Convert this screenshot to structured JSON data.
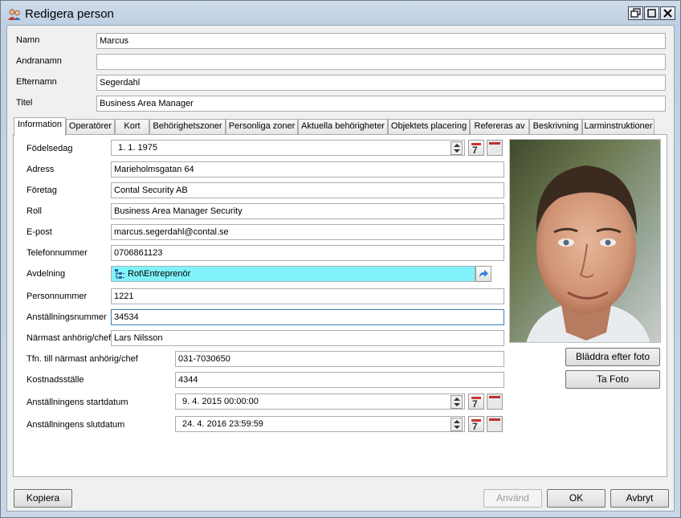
{
  "window": {
    "title": "Redigera person"
  },
  "header_fields": [
    {
      "label": "Namn",
      "value": "Marcus"
    },
    {
      "label": "Andranamn",
      "value": ""
    },
    {
      "label": "Efternamn",
      "value": "Segerdahl"
    },
    {
      "label": "Titel",
      "value": "Business Area Manager"
    }
  ],
  "tabs": [
    "Information",
    "Operatörer",
    "Kort",
    "Behörighetszoner",
    "Personliga zoner",
    "Aktuella behörigheter",
    "Objektets placering",
    "Refereras av",
    "Beskrivning",
    "Larminstruktioner"
  ],
  "active_tab": "Information",
  "info": {
    "birthday": {
      "label": "Födelsedag",
      "value": "1.   1. 1975"
    },
    "address": {
      "label": "Adress",
      "value": "Marieholmsgatan 64"
    },
    "company": {
      "label": "Företag",
      "value": "Contal Security AB"
    },
    "role": {
      "label": "Roll",
      "value": "Business Area Manager Security"
    },
    "email": {
      "label": "E-post",
      "value": "marcus.segerdahl@contal.se"
    },
    "phone": {
      "label": "Telefonnummer",
      "value": "0706861123"
    },
    "department": {
      "label": "Avdelning",
      "value": "Rot\\Entreprenör"
    },
    "person_number": {
      "label": "Personnummer",
      "value": "1221"
    },
    "employee_number": {
      "label": "Anställningsnummer",
      "value": "34534"
    },
    "next_of_kin": {
      "label": "Närmast anhörig/chef",
      "value": "Lars Nilsson"
    },
    "next_of_kin_phone": {
      "label": "Tfn. till närmast anhörig/chef",
      "value": "031-7030650"
    },
    "cost_center": {
      "label": "Kostnadsställe",
      "value": "4344"
    },
    "start_date": {
      "label": "Anställningens startdatum",
      "value": "9.   4. 2015 00:00:00"
    },
    "end_date": {
      "label": "Anställningens slutdatum",
      "value": "24.   4. 2016 23:59:59"
    }
  },
  "calendar_glyph": "7",
  "photo_buttons": {
    "browse": "Bläddra efter foto",
    "take": "Ta Foto"
  },
  "footer": {
    "copy": "Kopiera",
    "apply": "Använd",
    "ok": "OK",
    "cancel": "Avbryt"
  },
  "colors": {
    "department_bg": "#80f3fa",
    "focus_border": "#3c7fb1"
  }
}
